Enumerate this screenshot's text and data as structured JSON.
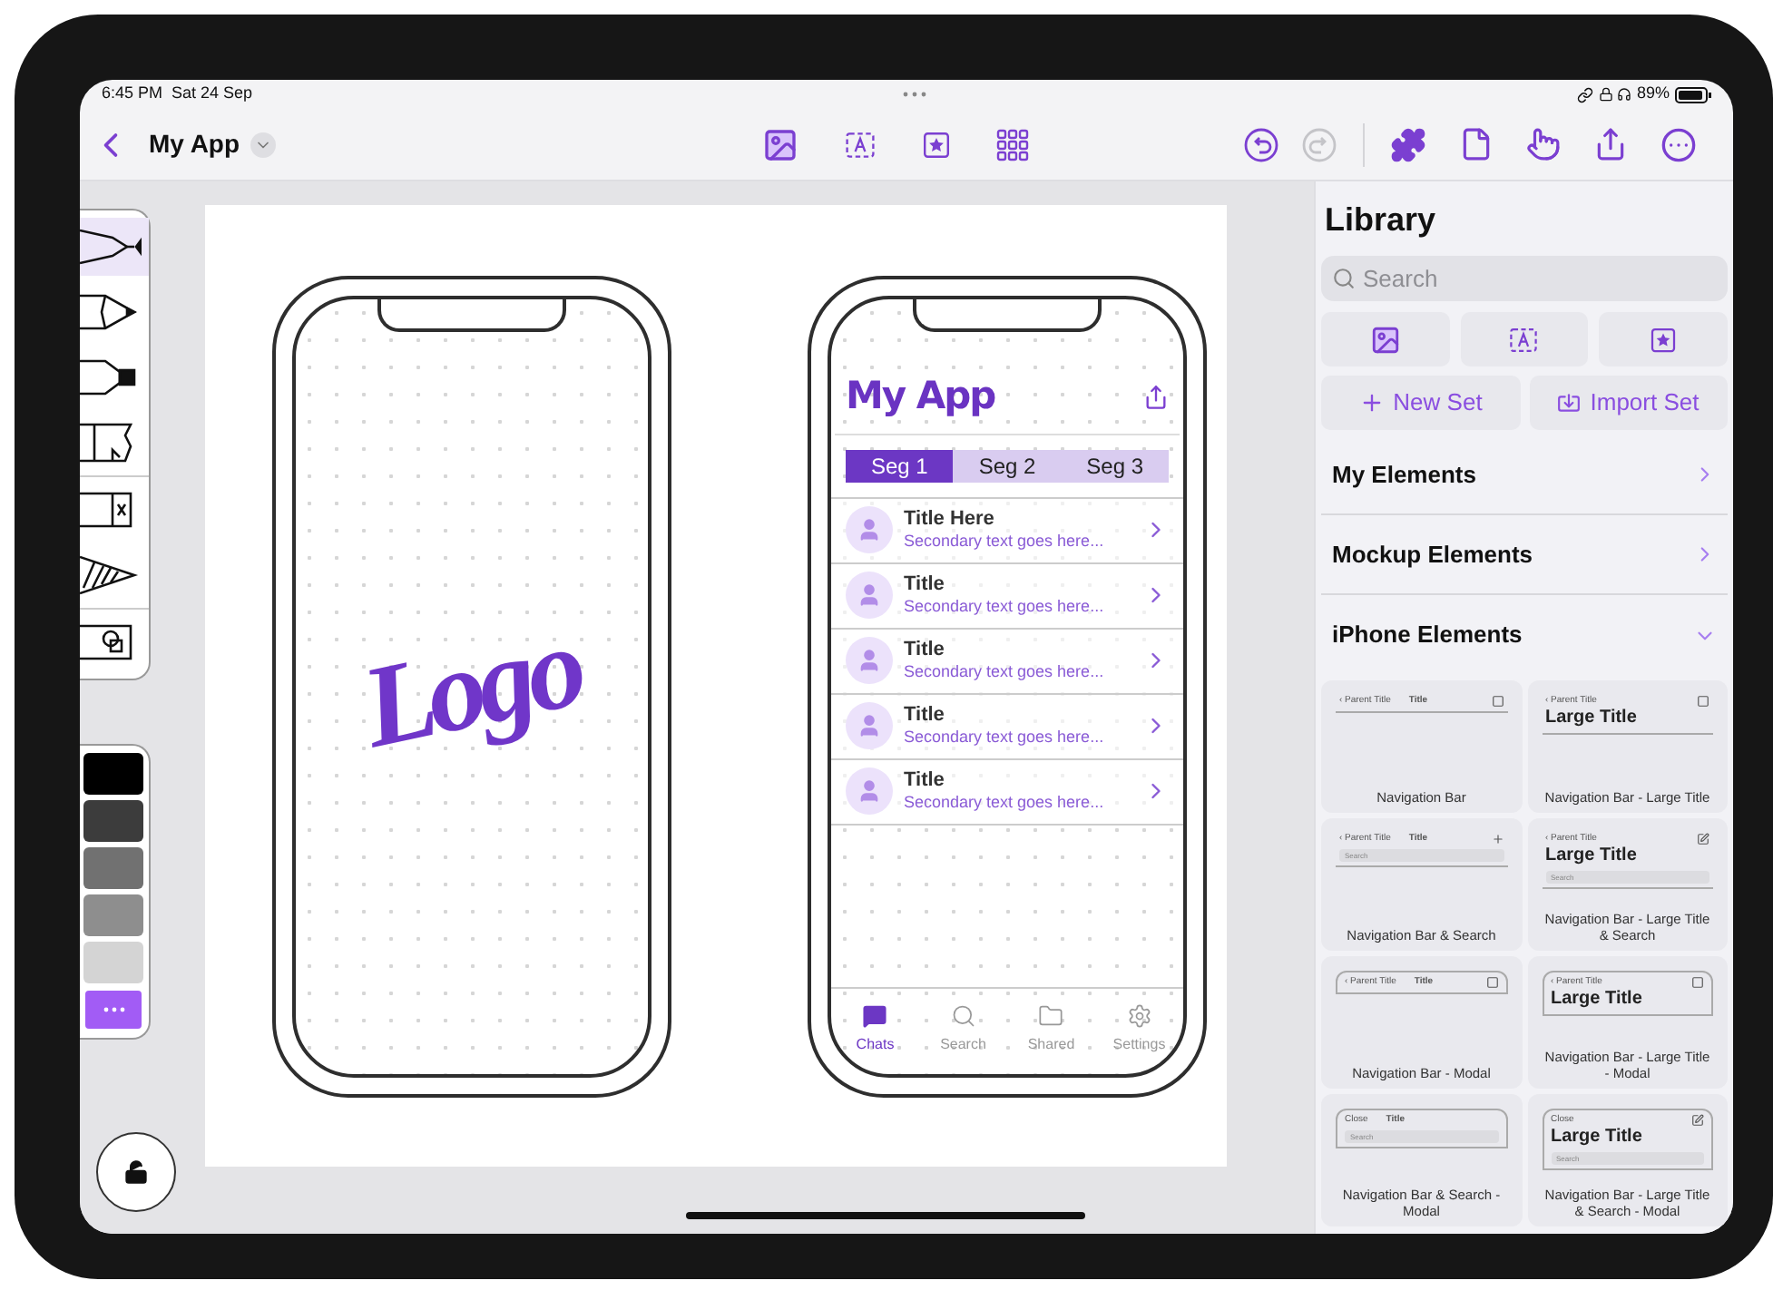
{
  "status_bar": {
    "time": "6:45 PM",
    "date": "Sat 24 Sep",
    "battery": "89%"
  },
  "toolbar": {
    "title": "My App",
    "redo": {
      "disabled": true
    }
  },
  "tool_groups": [
    {
      "tools": [
        {
          "kind": "pen",
          "selected": true
        },
        {
          "kind": "pencil",
          "selected": false
        },
        {
          "kind": "marker",
          "selected": false
        },
        {
          "kind": "brush",
          "selected": false
        }
      ]
    },
    {
      "tools": [
        {
          "kind": "eraser",
          "selected": false
        },
        {
          "kind": "hatch",
          "selected": false
        }
      ]
    },
    {
      "tools": [
        {
          "kind": "shapes",
          "selected": false
        }
      ]
    }
  ],
  "swatches": [
    {
      "kind": "color",
      "color": "#000000",
      "selected": false
    },
    {
      "kind": "color",
      "color": "#3c3c3c",
      "selected": false
    },
    {
      "kind": "color",
      "color": "#717171",
      "selected": false
    },
    {
      "kind": "color",
      "color": "#8e8e8e",
      "selected": false
    },
    {
      "kind": "color",
      "color": "#d4d4d4",
      "selected": false
    },
    {
      "kind": "more",
      "selected": true
    }
  ],
  "lock": {
    "locked": false
  },
  "splash_screen": {
    "logo": "Logo"
  },
  "app_screen": {
    "title": "My App",
    "segments": [
      {
        "label": "Seg 1",
        "selected": true
      },
      {
        "label": "Seg 2",
        "selected": false
      },
      {
        "label": "Seg 3",
        "selected": false
      }
    ],
    "rows": [
      {
        "title": "Title Here",
        "subtitle": "Secondary text goes here..."
      },
      {
        "title": "Title",
        "subtitle": "Secondary text goes here..."
      },
      {
        "title": "Title",
        "subtitle": "Secondary text goes here..."
      },
      {
        "title": "Title",
        "subtitle": "Secondary text goes here..."
      },
      {
        "title": "Title",
        "subtitle": "Secondary text goes here..."
      }
    ],
    "tabs": [
      {
        "kind": "chats",
        "label": "Chats",
        "selected": true
      },
      {
        "kind": "search",
        "label": "Search",
        "selected": false
      },
      {
        "kind": "shared",
        "label": "Shared",
        "selected": false
      },
      {
        "kind": "settings",
        "label": "Settings",
        "selected": false
      }
    ]
  },
  "library": {
    "title": "Library",
    "search": {
      "placeholder": "Search"
    },
    "actions": [
      {
        "kind": "new",
        "label": "New Set"
      },
      {
        "kind": "import",
        "label": "Import Set"
      }
    ],
    "sections": [
      {
        "label": "My Elements",
        "expanded": false
      },
      {
        "label": "Mockup Elements",
        "expanded": false
      },
      {
        "label": "iPhone Elements",
        "expanded": true
      }
    ],
    "elements": [
      {
        "name": "Navigation Bar",
        "kind": "compact",
        "leading": "‹ Parent Title",
        "title": "Title",
        "modal": false
      },
      {
        "name": "Navigation Bar - Large Title",
        "kind": "large",
        "leading": "‹ Parent Title",
        "title": "Large Title",
        "modal": false
      },
      {
        "name": "Navigation Bar & Search",
        "kind": "compact",
        "leading": "‹ Parent Title",
        "title": "Title",
        "search": "Search",
        "modal": false
      },
      {
        "name": "Navigation Bar - Large Title & Search",
        "kind": "large",
        "leading": "‹ Parent Title",
        "title": "Large Title",
        "search": "Search",
        "modal": false
      },
      {
        "name": "Navigation Bar - Modal",
        "kind": "compact",
        "leading": "‹ Parent Title",
        "title": "Title",
        "modal": true
      },
      {
        "name": "Navigation Bar - Large Title - Modal",
        "kind": "large",
        "leading": "‹ Parent Title",
        "title": "Large Title",
        "modal": true
      },
      {
        "name": "Navigation Bar & Search - Modal",
        "kind": "compact",
        "leading": "Close",
        "title": "Title",
        "search": "Search",
        "modal": true
      },
      {
        "name": "Navigation Bar - Large Title & Search - Modal",
        "kind": "large",
        "leading": "Close",
        "title": "Large Title",
        "search": "Search",
        "modal": true
      }
    ]
  }
}
